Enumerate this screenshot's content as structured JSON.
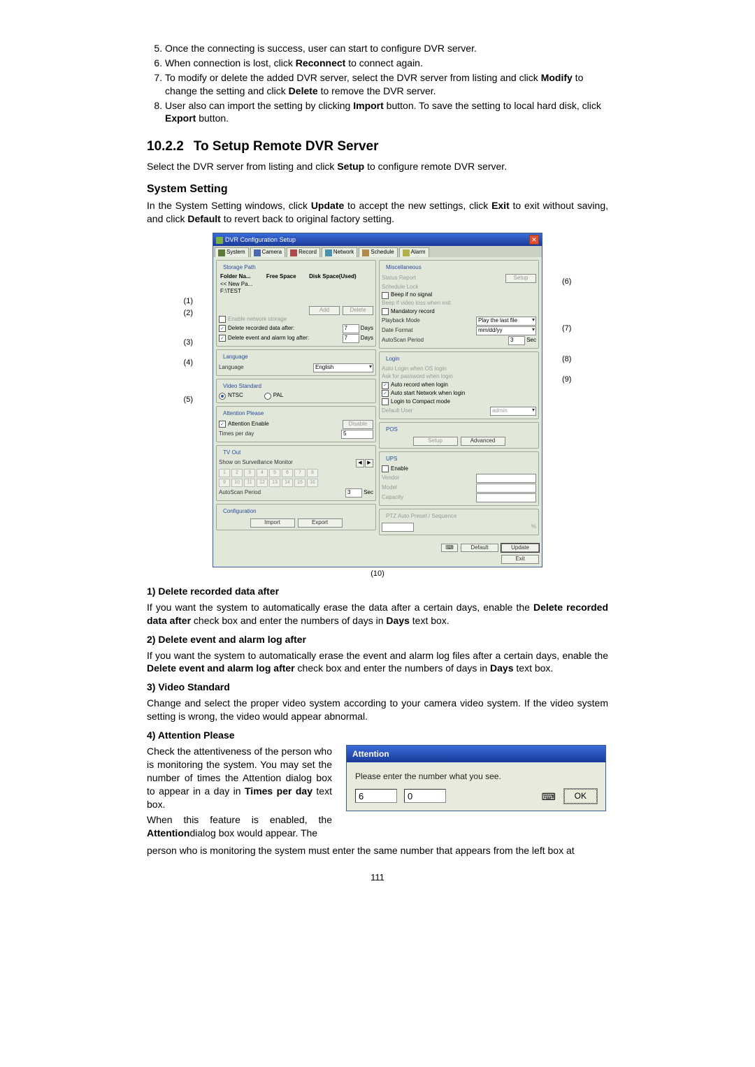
{
  "steps": {
    "s5": "Once the connecting is success, user can start to configure DVR server.",
    "s6_a": "When connection is lost, click ",
    "s6_b": "Reconnect",
    "s6_c": " to connect again.",
    "s7_a": "To modify or delete the added DVR server, select the DVR server from listing and click ",
    "s7_b": "Modify",
    "s7_c": " to change the setting and click ",
    "s7_d": "Delete",
    "s7_e": " to remove the DVR server.",
    "s8_a": "User also can import the setting by clicking ",
    "s8_b": "Import",
    "s8_c": " button. To save the setting to local hard disk, click ",
    "s8_d": "Export",
    "s8_e": " button."
  },
  "section": {
    "num": "10.2.2",
    "title": "To Setup Remote DVR Server"
  },
  "intro": {
    "a": "Select the DVR server from listing and click ",
    "b": "Setup",
    "c": " to configure remote DVR server."
  },
  "subhead": "System Setting",
  "syspara": {
    "a": "In the System Setting windows, click ",
    "b": "Update",
    "c": " to accept the new settings, click ",
    "d": "Exit",
    "e": " to exit without saving, and click ",
    "f": "Default",
    "g": " to revert back to original factory setting."
  },
  "callouts": {
    "l1": "(1)",
    "l2": "(2)",
    "l3": "(3)",
    "l4": "(4)",
    "l5": "(5)",
    "r6": "(6)",
    "r7": "(7)",
    "r8": "(8)",
    "r9": "(9)",
    "b10": "(10)"
  },
  "cfg": {
    "title": "DVR Configuration Setup",
    "tabs": [
      "System",
      "Camera",
      "Record",
      "Network",
      "Schedule",
      "Alarm"
    ],
    "storage": {
      "title": "Storage Path",
      "hdr": [
        "Folder Na...",
        "Free Space",
        "Disk Space(Used)"
      ],
      "rows": [
        "<< New Pa...",
        "F:\\TEST"
      ],
      "add": "Add",
      "delete": "Delete",
      "enable_net": "Enable network storage",
      "del_rec": "Delete recorded data after:",
      "del_rec_val": "7",
      "del_rec_unit": "Days",
      "del_log": "Delete event and alarm log after:",
      "del_log_val": "7",
      "del_log_unit": "Days"
    },
    "lang": {
      "title": "Language",
      "label": "Language",
      "value": "English"
    },
    "vstd": {
      "title": "Video Standard",
      "ntsc": "NTSC",
      "pal": "PAL"
    },
    "attn": {
      "title": "Attention Please",
      "enable": "Attention Enable",
      "disable_btn": "Disable",
      "times": "Times per day",
      "times_val": "5"
    },
    "tvout": {
      "title": "TV Out",
      "label": "Show on Surveillance Monitor",
      "cells": [
        "1",
        "2",
        "3",
        "4",
        "5",
        "6",
        "7",
        "8",
        "9",
        "10",
        "11",
        "12",
        "13",
        "14",
        "15",
        "16"
      ],
      "auto": "AutoScan Period",
      "auto_val": "3",
      "sec": "Sec"
    },
    "confg": {
      "title": "Configuration",
      "import": "Import",
      "export": "Export"
    },
    "misc": {
      "title": "Miscellaneous",
      "status": "Status Report",
      "setup": "Setup",
      "sched": "Schedule Lock",
      "beep": "Beep if no signal",
      "beep2": "Beep if video loss when exit",
      "mand": "Mandatory record",
      "play": "Playback Mode",
      "play_val": "Play the last file",
      "datef": "Date Format",
      "datef_val": "mm/dd/yy",
      "autoscan": "AutoScan Period",
      "autoscan_val": "3",
      "sec": "Sec"
    },
    "login": {
      "title": "Login",
      "auto_login": "Auto Login when OS login",
      "ask_pw": "Ask for password when login",
      "auto_rec": "Auto record when login",
      "auto_net": "Auto start Network when login",
      "compact": "Login to Compact mode",
      "def_user": "Default User",
      "user_val": "admin"
    },
    "pos": {
      "title": "POS",
      "setup": "Setup",
      "adv": "Advanced"
    },
    "ups": {
      "title": "UPS",
      "enable": "Enable",
      "vendor": "Vendor",
      "model": "Model",
      "capacity": "Capacity"
    },
    "ptz": {
      "title": "PTZ Auto Preset / Sequence",
      "pct": "%"
    },
    "bottom": {
      "default": "Default",
      "update": "Update",
      "exit": "Exit"
    }
  },
  "items": {
    "i1_t": "1) Delete recorded data after",
    "i1_a": "If you want the system to automatically erase the data after a certain days, enable the ",
    "i1_b": "Delete recorded data after",
    "i1_c": " check box and enter the numbers of days in ",
    "i1_d": "Days",
    "i1_e": " text box.",
    "i2_t": "2) Delete event and alarm log after",
    "i2_a": "If you want the system to automatically erase the event and alarm log files after a certain days, enable the ",
    "i2_b": "Delete event and alarm log after",
    "i2_c": " check box and enter the numbers of days in ",
    "i2_d": "Days",
    "i2_e": " text box.",
    "i3_t": "3) Video Standard",
    "i3_a": "Change and select the proper video system according to your camera video system. If the video system setting is wrong, the video would appear abnormal.",
    "i4_t": "4) Attention Please",
    "i4_a": "Check the attentiveness of the person who is monitoring the system. You may set the number of times the Attention dialog box to appear in a day in ",
    "i4_b": "Times per day",
    "i4_c": " text box.",
    "i4_d": "When this feature is enabled, the ",
    "i4_e": "Attention",
    "i4_f": " dialog box would appear. The person who is monitoring the system must enter the same number that appears from the left box at"
  },
  "attn_dlg": {
    "title": "Attention",
    "msg": "Please enter the number what you see.",
    "v1": "6",
    "v2": "0",
    "ok": "OK"
  },
  "page_num": "111"
}
